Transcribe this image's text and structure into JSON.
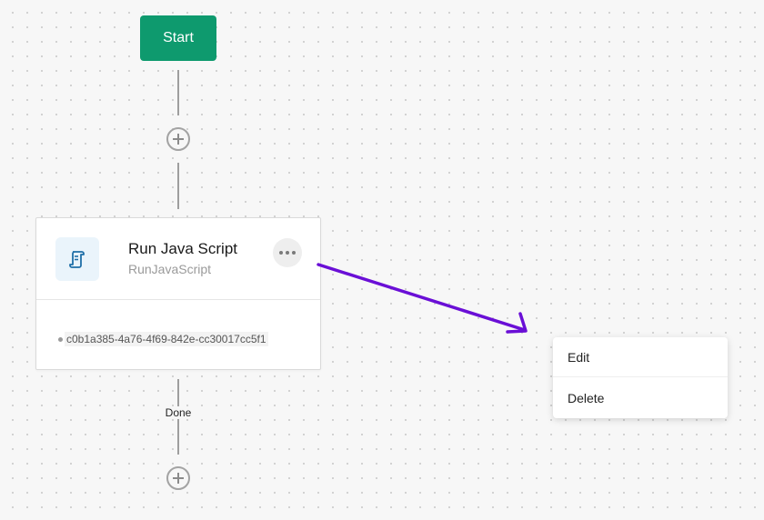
{
  "flow": {
    "start_label": "Start",
    "done_label": "Done"
  },
  "step": {
    "title": "Run Java Script",
    "subtitle": "RunJavaScript",
    "id": "c0b1a385-4a76-4f69-842e-cc30017cc5f1",
    "icon": "script-scroll-icon"
  },
  "context_menu": {
    "items": [
      {
        "label": "Edit"
      },
      {
        "label": "Delete"
      }
    ]
  },
  "colors": {
    "start": "#0e9a6e",
    "annotation_arrow": "#6a0fd6",
    "icon_accent": "#1f6fa8"
  }
}
